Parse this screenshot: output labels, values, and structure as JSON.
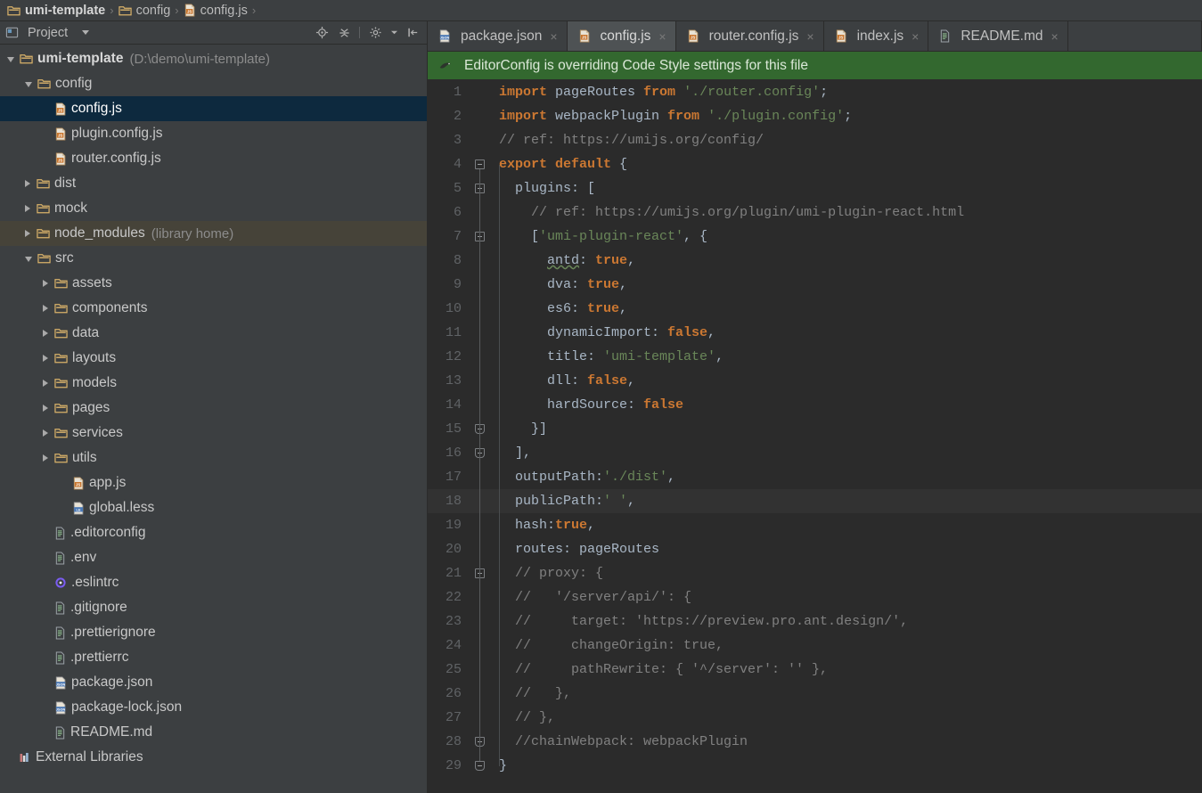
{
  "breadcrumb": {
    "items": [
      {
        "label": "umi-template",
        "icon": "folder-icon",
        "bold": true
      },
      {
        "label": "config",
        "icon": "folder-icon",
        "bold": false
      },
      {
        "label": "config.js",
        "icon": "js-file-icon",
        "bold": false
      }
    ],
    "separator": "›"
  },
  "project_panel": {
    "title": "Project",
    "title_icon": "project-icon",
    "dropdown_icon": "chevron-down-icon",
    "tools": [
      {
        "name": "locate-target-icon",
        "label": "Select Opened File"
      },
      {
        "name": "collapse-all-icon",
        "label": "Collapse All"
      },
      {
        "name": "settings-gear-icon",
        "label": "Settings"
      },
      {
        "name": "hide-panel-icon",
        "label": "Hide"
      }
    ],
    "tree": [
      {
        "label": "umi-template",
        "hint": "(D:\\demo\\umi-template)",
        "indent": 0,
        "state": "open",
        "icon": "folder-icon",
        "bold": true,
        "selected": false,
        "libhome": false
      },
      {
        "label": "config",
        "hint": "",
        "indent": 1,
        "state": "open",
        "icon": "folder-icon",
        "bold": false,
        "selected": false,
        "libhome": false
      },
      {
        "label": "config.js",
        "hint": "",
        "indent": 2,
        "state": "leaf",
        "icon": "js-file-icon",
        "bold": false,
        "selected": true,
        "libhome": false
      },
      {
        "label": "plugin.config.js",
        "hint": "",
        "indent": 2,
        "state": "leaf",
        "icon": "js-file-icon",
        "bold": false,
        "selected": false,
        "libhome": false
      },
      {
        "label": "router.config.js",
        "hint": "",
        "indent": 2,
        "state": "leaf",
        "icon": "js-file-icon",
        "bold": false,
        "selected": false,
        "libhome": false
      },
      {
        "label": "dist",
        "hint": "",
        "indent": 1,
        "state": "closed",
        "icon": "folder-icon",
        "bold": false,
        "selected": false,
        "libhome": false
      },
      {
        "label": "mock",
        "hint": "",
        "indent": 1,
        "state": "closed",
        "icon": "folder-icon",
        "bold": false,
        "selected": false,
        "libhome": false
      },
      {
        "label": "node_modules",
        "hint": "(library home)",
        "indent": 1,
        "state": "closed",
        "icon": "folder-icon",
        "bold": false,
        "selected": false,
        "libhome": true
      },
      {
        "label": "src",
        "hint": "",
        "indent": 1,
        "state": "open",
        "icon": "folder-icon",
        "bold": false,
        "selected": false,
        "libhome": false
      },
      {
        "label": "assets",
        "hint": "",
        "indent": 2,
        "state": "closed",
        "icon": "folder-icon",
        "bold": false,
        "selected": false,
        "libhome": false
      },
      {
        "label": "components",
        "hint": "",
        "indent": 2,
        "state": "closed",
        "icon": "folder-icon",
        "bold": false,
        "selected": false,
        "libhome": false
      },
      {
        "label": "data",
        "hint": "",
        "indent": 2,
        "state": "closed",
        "icon": "folder-icon",
        "bold": false,
        "selected": false,
        "libhome": false
      },
      {
        "label": "layouts",
        "hint": "",
        "indent": 2,
        "state": "closed",
        "icon": "folder-icon",
        "bold": false,
        "selected": false,
        "libhome": false
      },
      {
        "label": "models",
        "hint": "",
        "indent": 2,
        "state": "closed",
        "icon": "folder-icon",
        "bold": false,
        "selected": false,
        "libhome": false
      },
      {
        "label": "pages",
        "hint": "",
        "indent": 2,
        "state": "closed",
        "icon": "folder-icon",
        "bold": false,
        "selected": false,
        "libhome": false
      },
      {
        "label": "services",
        "hint": "",
        "indent": 2,
        "state": "closed",
        "icon": "folder-icon",
        "bold": false,
        "selected": false,
        "libhome": false
      },
      {
        "label": "utils",
        "hint": "",
        "indent": 2,
        "state": "closed",
        "icon": "folder-icon",
        "bold": false,
        "selected": false,
        "libhome": false
      },
      {
        "label": "app.js",
        "hint": "",
        "indent": 3,
        "state": "leaf",
        "icon": "js-file-icon",
        "bold": false,
        "selected": false,
        "libhome": false
      },
      {
        "label": "global.less",
        "hint": "",
        "indent": 3,
        "state": "leaf",
        "icon": "less-file-icon",
        "bold": false,
        "selected": false,
        "libhome": false
      },
      {
        "label": ".editorconfig",
        "hint": "",
        "indent": 2,
        "state": "leaf",
        "icon": "text-file-icon",
        "bold": false,
        "selected": false,
        "libhome": false
      },
      {
        "label": ".env",
        "hint": "",
        "indent": 2,
        "state": "leaf",
        "icon": "text-file-icon",
        "bold": false,
        "selected": false,
        "libhome": false
      },
      {
        "label": ".eslintrc",
        "hint": "",
        "indent": 2,
        "state": "leaf",
        "icon": "eslint-file-icon",
        "bold": false,
        "selected": false,
        "libhome": false
      },
      {
        "label": ".gitignore",
        "hint": "",
        "indent": 2,
        "state": "leaf",
        "icon": "text-file-icon",
        "bold": false,
        "selected": false,
        "libhome": false
      },
      {
        "label": ".prettierignore",
        "hint": "",
        "indent": 2,
        "state": "leaf",
        "icon": "text-file-icon",
        "bold": false,
        "selected": false,
        "libhome": false
      },
      {
        "label": ".prettierrc",
        "hint": "",
        "indent": 2,
        "state": "leaf",
        "icon": "text-file-icon",
        "bold": false,
        "selected": false,
        "libhome": false
      },
      {
        "label": "package.json",
        "hint": "",
        "indent": 2,
        "state": "leaf",
        "icon": "json-file-icon",
        "bold": false,
        "selected": false,
        "libhome": false
      },
      {
        "label": "package-lock.json",
        "hint": "",
        "indent": 2,
        "state": "leaf",
        "icon": "json-file-icon",
        "bold": false,
        "selected": false,
        "libhome": false
      },
      {
        "label": "README.md",
        "hint": "",
        "indent": 2,
        "state": "leaf",
        "icon": "text-file-icon",
        "bold": false,
        "selected": false,
        "libhome": false
      },
      {
        "label": "External Libraries",
        "hint": "",
        "indent": 0,
        "state": "leaf",
        "icon": "external-libraries-icon",
        "bold": false,
        "selected": false,
        "libhome": false
      }
    ]
  },
  "editor_tabs": {
    "close_glyph": "×",
    "items": [
      {
        "label": "package.json",
        "icon": "json-file-icon",
        "active": false
      },
      {
        "label": "config.js",
        "icon": "js-file-icon",
        "active": true
      },
      {
        "label": "router.config.js",
        "icon": "js-file-icon",
        "active": false
      },
      {
        "label": "index.js",
        "icon": "js-file-icon",
        "active": false
      },
      {
        "label": "README.md",
        "icon": "text-file-icon",
        "active": false
      }
    ]
  },
  "notification": {
    "icon": "editorconfig-icon",
    "message": "EditorConfig is overriding Code Style settings for this file",
    "background": "#33682f"
  },
  "code": {
    "current_line": 18,
    "lines": [
      {
        "n": 1,
        "fold": "",
        "tokens": [
          {
            "t": "kw",
            "s": "import"
          },
          {
            "t": "plain",
            "s": " pageRoutes "
          },
          {
            "t": "kw",
            "s": "from"
          },
          {
            "t": "plain",
            "s": " "
          },
          {
            "t": "str",
            "s": "'./router.config'"
          },
          {
            "t": "plain",
            "s": ";"
          }
        ]
      },
      {
        "n": 2,
        "fold": "",
        "tokens": [
          {
            "t": "kw",
            "s": "import"
          },
          {
            "t": "plain",
            "s": " webpackPlugin "
          },
          {
            "t": "kw",
            "s": "from"
          },
          {
            "t": "plain",
            "s": " "
          },
          {
            "t": "str",
            "s": "'./plugin.config'"
          },
          {
            "t": "plain",
            "s": ";"
          }
        ]
      },
      {
        "n": 3,
        "fold": "",
        "tokens": [
          {
            "t": "cmt",
            "s": "// ref: https://umijs.org/config/"
          }
        ]
      },
      {
        "n": 4,
        "fold": "start",
        "tokens": [
          {
            "t": "kw",
            "s": "export default"
          },
          {
            "t": "plain",
            "s": " {"
          }
        ]
      },
      {
        "n": 5,
        "fold": "start",
        "tokens": [
          {
            "t": "plain",
            "s": "  plugins: ["
          }
        ]
      },
      {
        "n": 6,
        "fold": "",
        "tokens": [
          {
            "t": "plain",
            "s": "    "
          },
          {
            "t": "cmt",
            "s": "// ref: https://umijs.org/plugin/umi-plugin-react.html"
          }
        ]
      },
      {
        "n": 7,
        "fold": "start",
        "tokens": [
          {
            "t": "plain",
            "s": "    ["
          },
          {
            "t": "str",
            "s": "'umi-plugin-react'"
          },
          {
            "t": "plain",
            "s": ", {"
          }
        ]
      },
      {
        "n": 8,
        "fold": "",
        "tokens": [
          {
            "t": "plain",
            "s": "      "
          },
          {
            "t": "spell",
            "s": "antd"
          },
          {
            "t": "plain",
            "s": ": "
          },
          {
            "t": "kw",
            "s": "true"
          },
          {
            "t": "plain",
            "s": ","
          }
        ]
      },
      {
        "n": 9,
        "fold": "",
        "tokens": [
          {
            "t": "plain",
            "s": "      dva: "
          },
          {
            "t": "kw",
            "s": "true"
          },
          {
            "t": "plain",
            "s": ","
          }
        ]
      },
      {
        "n": 10,
        "fold": "",
        "tokens": [
          {
            "t": "plain",
            "s": "      es6: "
          },
          {
            "t": "kw",
            "s": "true"
          },
          {
            "t": "plain",
            "s": ","
          }
        ]
      },
      {
        "n": 11,
        "fold": "",
        "tokens": [
          {
            "t": "plain",
            "s": "      dynamicImport: "
          },
          {
            "t": "kw",
            "s": "false"
          },
          {
            "t": "plain",
            "s": ","
          }
        ]
      },
      {
        "n": 12,
        "fold": "",
        "tokens": [
          {
            "t": "plain",
            "s": "      title: "
          },
          {
            "t": "str",
            "s": "'umi-template'"
          },
          {
            "t": "plain",
            "s": ","
          }
        ]
      },
      {
        "n": 13,
        "fold": "",
        "tokens": [
          {
            "t": "plain",
            "s": "      dll: "
          },
          {
            "t": "kw",
            "s": "false"
          },
          {
            "t": "plain",
            "s": ","
          }
        ]
      },
      {
        "n": 14,
        "fold": "",
        "tokens": [
          {
            "t": "plain",
            "s": "      hardSource: "
          },
          {
            "t": "kw",
            "s": "false"
          }
        ]
      },
      {
        "n": 15,
        "fold": "end",
        "tokens": [
          {
            "t": "plain",
            "s": "    }]"
          }
        ]
      },
      {
        "n": 16,
        "fold": "end",
        "tokens": [
          {
            "t": "plain",
            "s": "  ],"
          }
        ]
      },
      {
        "n": 17,
        "fold": "",
        "tokens": [
          {
            "t": "plain",
            "s": "  outputPath:"
          },
          {
            "t": "str",
            "s": "'./dist'"
          },
          {
            "t": "plain",
            "s": ","
          }
        ]
      },
      {
        "n": 18,
        "fold": "",
        "tokens": [
          {
            "t": "plain",
            "s": "  publicPath:"
          },
          {
            "t": "str",
            "s": "' '"
          },
          {
            "t": "plain",
            "s": ","
          }
        ]
      },
      {
        "n": 19,
        "fold": "",
        "tokens": [
          {
            "t": "plain",
            "s": "  hash:"
          },
          {
            "t": "kw",
            "s": "true"
          },
          {
            "t": "plain",
            "s": ","
          }
        ]
      },
      {
        "n": 20,
        "fold": "",
        "tokens": [
          {
            "t": "plain",
            "s": "  routes: pageRoutes"
          }
        ]
      },
      {
        "n": 21,
        "fold": "start",
        "tokens": [
          {
            "t": "cmt",
            "s": "  // proxy: {"
          }
        ]
      },
      {
        "n": 22,
        "fold": "",
        "tokens": [
          {
            "t": "cmt",
            "s": "  //   '/server/api/': {"
          }
        ]
      },
      {
        "n": 23,
        "fold": "",
        "tokens": [
          {
            "t": "cmt",
            "s": "  //     target: 'https://preview.pro.ant.design/',"
          }
        ]
      },
      {
        "n": 24,
        "fold": "",
        "tokens": [
          {
            "t": "cmt",
            "s": "  //     changeOrigin: true,"
          }
        ]
      },
      {
        "n": 25,
        "fold": "",
        "tokens": [
          {
            "t": "cmt",
            "s": "  //     pathRewrite: { '^/server': '' },"
          }
        ]
      },
      {
        "n": 26,
        "fold": "",
        "tokens": [
          {
            "t": "cmt",
            "s": "  //   },"
          }
        ]
      },
      {
        "n": 27,
        "fold": "",
        "tokens": [
          {
            "t": "cmt",
            "s": "  // },"
          }
        ]
      },
      {
        "n": 28,
        "fold": "end",
        "tokens": [
          {
            "t": "cmt",
            "s": "  //chainWebpack: webpackPlugin"
          }
        ]
      },
      {
        "n": 29,
        "fold": "end",
        "tokens": [
          {
            "t": "plain",
            "s": "}"
          }
        ]
      }
    ]
  }
}
